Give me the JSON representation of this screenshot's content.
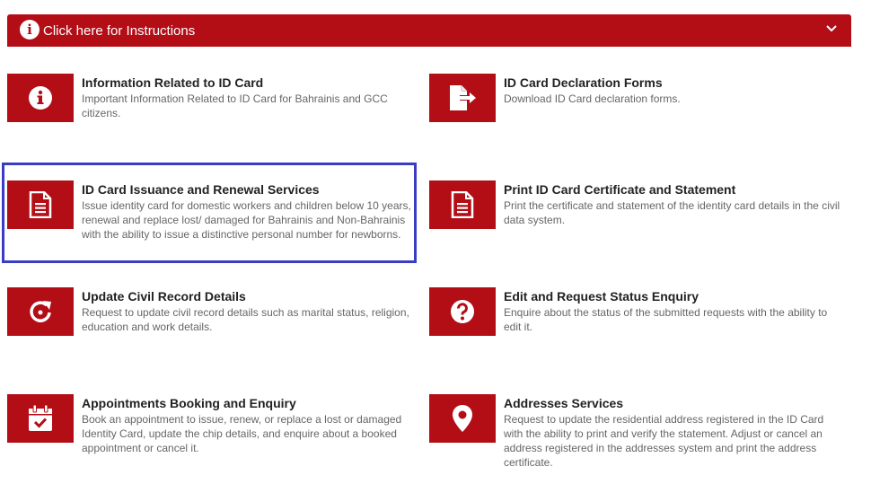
{
  "instructions": {
    "label": "Click here for Instructions",
    "info_icon": "info-circle-icon",
    "chevron_icon": "chevron-down-icon",
    "bar_color": "#b30d16"
  },
  "highlight_color": "#3a3cc4",
  "services": [
    {
      "title": "Information Related to ID Card",
      "description": "Important Information Related to ID Card for Bahrainis and GCC citizens.",
      "icon": "info-icon"
    },
    {
      "title": "ID Card Declaration Forms",
      "description": "Download ID Card declaration forms.",
      "icon": "file-export-icon"
    },
    {
      "title": "ID Card Issuance and Renewal Services",
      "description": "Issue identity card for domestic workers and children below 10 years, renewal and replace lost/ damaged for Bahrainis and Non-Bahrainis with the ability to issue a distinctive personal number for newborns.",
      "icon": "document-icon"
    },
    {
      "title": "Print ID Card Certificate and Statement",
      "description": "Print the certificate and statement of the identity card details in the civil data system.",
      "icon": "document-icon"
    },
    {
      "title": "Update Civil Record Details",
      "description": "Request to update civil record details such as marital status, religion, education and work details.",
      "icon": "refresh-icon"
    },
    {
      "title": "Edit and Request Status Enquiry",
      "description": "Enquire about the status of the submitted requests with the ability to edit it.",
      "icon": "question-icon"
    },
    {
      "title": "Appointments Booking and Enquiry",
      "description": "Book an appointment to issue, renew, or replace a lost or damaged Identity Card, update the chip details, and enquire about a booked appointment or cancel it.",
      "icon": "calendar-check-icon"
    },
    {
      "title": "Addresses Services",
      "description": "Request to update the residential address registered in the ID Card with the ability to print and verify the statement. Adjust or cancel an address registered in the addresses system and print the address certificate.",
      "icon": "map-marker-icon"
    }
  ]
}
